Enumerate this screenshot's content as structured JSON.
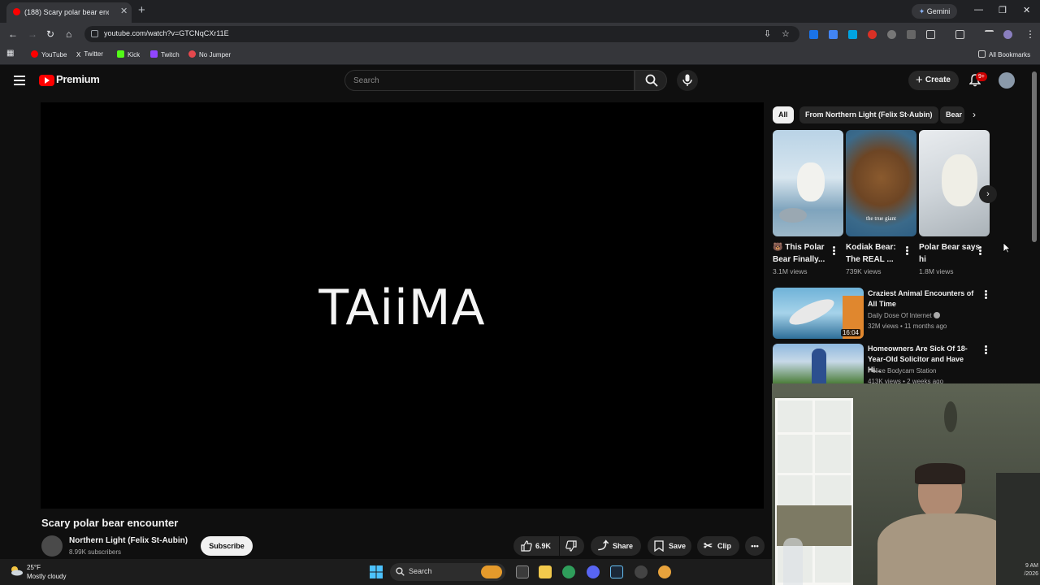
{
  "browser": {
    "tab_title": "(188) Scary polar bear enco",
    "url": "youtube.com/watch?v=GTCNqCXr11E",
    "gemini_label": "Gemini",
    "bookmarks": [
      "YouTube",
      "Twitter",
      "Kick",
      "Twitch",
      "No Jumper"
    ],
    "all_bookmarks": "All Bookmarks"
  },
  "youtube": {
    "logo_text": "Premium",
    "search_placeholder": "Search",
    "create_label": "Create",
    "notification_count": "9+"
  },
  "video": {
    "overlay_text": "TAiiMA",
    "title": "Scary polar bear encounter",
    "channel": "Northern Light (Felix St-Aubin)",
    "subscribers": "8.99K subscribers",
    "subscribe_label": "Subscribe",
    "likes": "6.9K",
    "share_label": "Share",
    "save_label": "Save",
    "clip_label": "Clip"
  },
  "sidebar": {
    "chips": [
      "All",
      "From Northern Light (Felix St-Aubin)",
      "Bear"
    ],
    "shorts": [
      {
        "title": "🐻 This Polar Bear Finally...",
        "views": "3.1M views"
      },
      {
        "title": "Kodiak Bear: The REAL ...",
        "views": "739K views",
        "thumb_caption": "the true giant"
      },
      {
        "title": "Polar Bear says hi",
        "views": "1.8M views"
      }
    ],
    "videos": [
      {
        "title": "Craziest Animal Encounters of All Time",
        "channel": "Daily Dose Of Internet",
        "meta": "32M views • 11 months ago",
        "duration": "16:04"
      },
      {
        "title": "Homeowners Are Sick Of 18-Year-Old Solicitor and Have Hi...",
        "channel": "Police Bodycam Station",
        "meta": "413K views • 2 weeks ago"
      }
    ]
  },
  "taskbar": {
    "temperature": "25°F",
    "condition": "Mostly cloudy",
    "search_label": "Search",
    "clock": "9 AM",
    "date": "/2026"
  }
}
